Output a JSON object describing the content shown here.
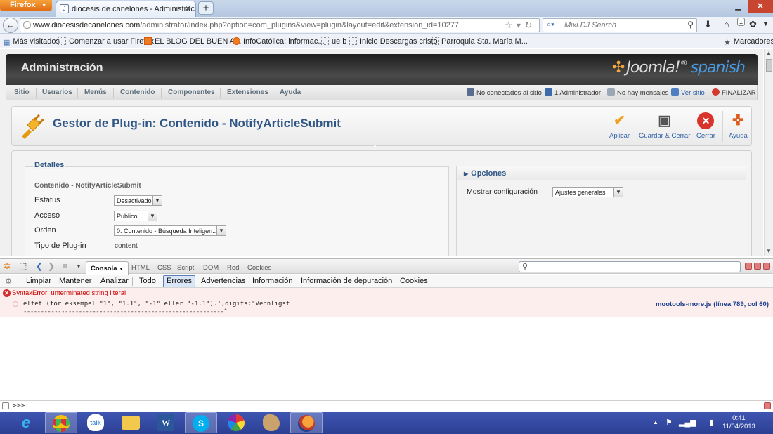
{
  "browser": {
    "menu_button": "Firefox",
    "tab_title": "diocesis de canelones - Administración",
    "new_tab": "+",
    "url_domain": "www.diocesisdecanelones.com",
    "url_path": "/administrator/index.php?option=com_plugins&view=plugin&layout=edit&extension_id=10277",
    "search_placeholder": "Mixi.DJ Search",
    "bookmarks": [
      "Más visitados",
      "Comenzar a usar Firefox",
      "EL BLOG DEL BUEN A...",
      "InfoCatólica: informac...",
      "ue b",
      "Inicio Descargas cristo",
      "Parroquia Sta. María M..."
    ],
    "bookmarks_menu": "Marcadores",
    "notification_count": "1"
  },
  "admin": {
    "header_title": "Administración",
    "logo_word": "Joomla!",
    "logo_lang": "spanish",
    "menu": [
      "Sitio",
      "Usuarios",
      "Menús",
      "Contenido",
      "Componentes",
      "Extensiones",
      "Ayuda"
    ],
    "status": {
      "not_connected": "No conectados al sitio",
      "admins": "1 Administrador",
      "messages": "No hay mensajes",
      "view_site": "Ver sitio",
      "logout": "FINALIZAR"
    },
    "page_heading": "Gestor de Plug-in: Contenido - NotifyArticleSubmit",
    "toolbar": {
      "apply": "Aplicar",
      "save_close": "Guardar & Cerrar",
      "close": "Cerrar",
      "help": "Ayuda"
    },
    "details": {
      "legend": "Detalles",
      "extension_name": "Contenido - NotifyArticleSubmit",
      "status_label": "Estatus",
      "status_value": "Desactivado",
      "access_label": "Acceso",
      "access_value": "Publico",
      "order_label": "Orden",
      "order_value": "0. Contenido - Búsqueda Inteligen...",
      "type_label": "Tipo de Plug-in",
      "type_value": "content"
    },
    "options": {
      "heading": "Opciones",
      "show_config_label": "Mostrar configuración",
      "show_config_value": "Ajustes generales"
    }
  },
  "firebug": {
    "panels": [
      "Consola",
      "HTML",
      "CSS",
      "Script",
      "DOM",
      "Red",
      "Cookies"
    ],
    "console_buttons": [
      "Limpiar",
      "Mantener",
      "Analizar"
    ],
    "filters": [
      "Todo",
      "Errores",
      "Advertencias",
      "Información",
      "Información de depuración",
      "Cookies"
    ],
    "error": {
      "message": "SyntaxError: unterminated string literal",
      "code": "eltet (for eksempel \"1\", \"1.1\", \"-1\" eller \"-1.1\").',digits:\"Vennligst",
      "underline": "----------------------------------------------------------^",
      "source": "mootools-more.js (línea 789, col 60)"
    },
    "prompt": ">>>"
  },
  "taskbar": {
    "time": "0:41",
    "date": "11/04/2013"
  },
  "colors": {
    "joomla_blue": "#2f5684",
    "apply_orange": "#f0a020",
    "close_red": "#d9342b",
    "error_red": "#c00000"
  }
}
